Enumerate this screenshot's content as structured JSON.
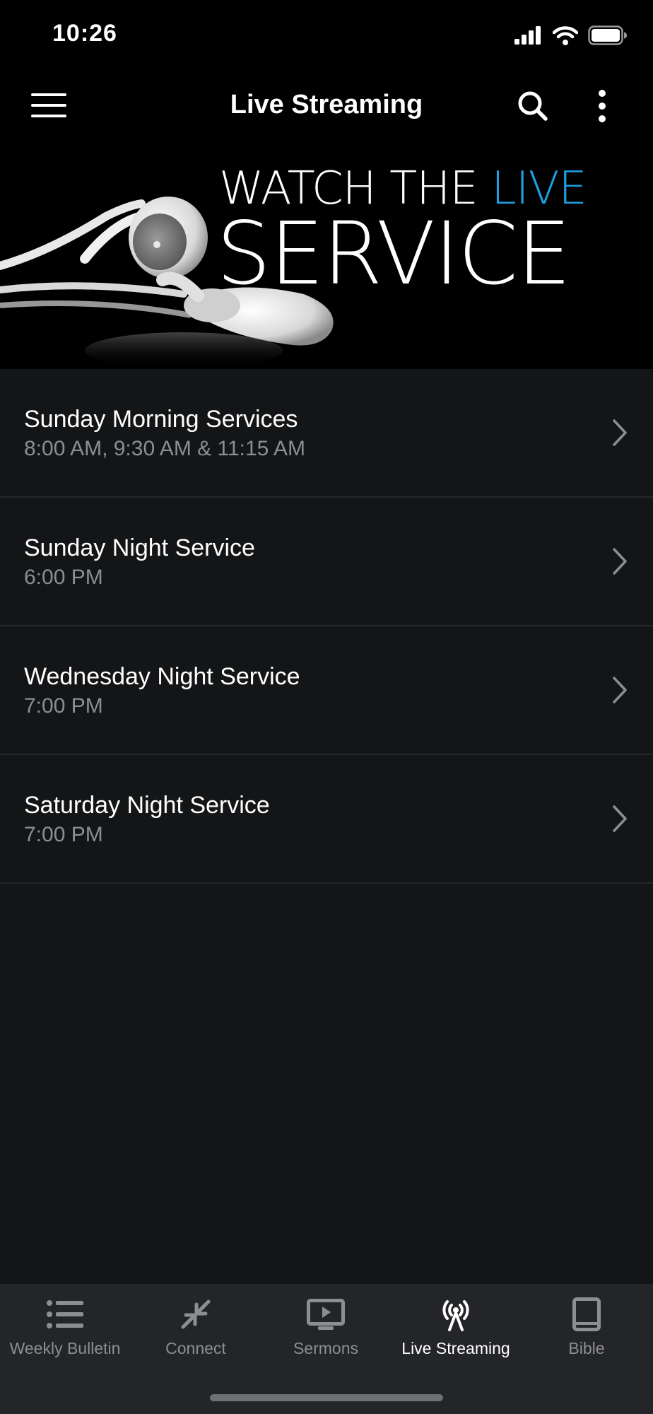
{
  "status_bar": {
    "time": "10:26"
  },
  "app_bar": {
    "title": "Live Streaming"
  },
  "hero": {
    "line1_main": "WATCH THE ",
    "line1_accent": "LIVE",
    "line2": "SERVICE",
    "accent_color": "#1e9fe0"
  },
  "services": [
    {
      "title": "Sunday Morning Services",
      "subtitle": "8:00 AM, 9:30 AM & 11:15 AM"
    },
    {
      "title": "Sunday Night Service",
      "subtitle": "6:00 PM"
    },
    {
      "title": "Wednesday Night Service",
      "subtitle": "7:00 PM"
    },
    {
      "title": "Saturday Night Service",
      "subtitle": "7:00 PM"
    }
  ],
  "tabs": [
    {
      "label": "Weekly Bulletin",
      "icon": "list-icon",
      "active": false
    },
    {
      "label": "Connect",
      "icon": "compress-arrows-icon",
      "active": false
    },
    {
      "label": "Sermons",
      "icon": "video-play-icon",
      "active": false
    },
    {
      "label": "Live Streaming",
      "icon": "broadcast-tower-icon",
      "active": true
    },
    {
      "label": "Bible",
      "icon": "book-icon",
      "active": false
    }
  ],
  "colors": {
    "background": "#141517",
    "tab_bar": "#242528",
    "inactive_text": "#8d8e92"
  }
}
